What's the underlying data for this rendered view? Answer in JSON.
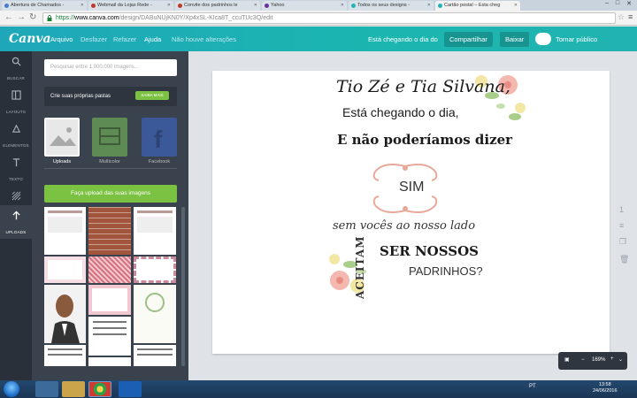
{
  "browser": {
    "tabs": [
      {
        "label": "Abertura de Chamados -",
        "color": "#4a7bd0"
      },
      {
        "label": "Webmail da Lojas Rede -",
        "color": "#c0392b"
      },
      {
        "label": "Convite dos padrinhos le",
        "color": "#c0392b"
      },
      {
        "label": "Yahoo",
        "color": "#6b2fa0"
      },
      {
        "label": "Todos os seus designs -",
        "color": "#1fb5b8"
      },
      {
        "label": "Cartão postal – Esta cheg",
        "color": "#1fb5b8"
      }
    ],
    "url_scheme": "https://",
    "url_host": "www.canva.com",
    "url_path": "/design/DABuNUjKN0Y/Xp4xSL-KIca8T_ccuTUc3Q/edit",
    "back_icon": "back-arrow-icon",
    "forward_icon": "forward-arrow-icon",
    "reload_icon": "reload-icon"
  },
  "header": {
    "logo": "Canva",
    "menu": [
      "Arquivo",
      "Desfazer",
      "Refazer",
      "Ajuda"
    ],
    "status": "Não houve alterações",
    "design_title": "Está chegando o dia do",
    "share": "Compartilhar",
    "download": "Baixar",
    "make_public": "Tornar público"
  },
  "rail": [
    {
      "label": "BUSCAR",
      "icon": "search-icon",
      "active": false
    },
    {
      "label": "LAYOUTS",
      "icon": "layouts-icon",
      "active": false
    },
    {
      "label": "ELEMENTOS",
      "icon": "elements-icon",
      "active": false
    },
    {
      "label": "TEXTO",
      "icon": "text-icon",
      "active": false
    },
    {
      "label": "FUNDO",
      "icon": "background-icon",
      "active": false
    },
    {
      "label": "UPLOADS",
      "icon": "upload-icon",
      "active": true
    }
  ],
  "panel": {
    "search_placeholder": "Pesquisar entre 1.000.000 imagens...",
    "folder_label": "Crie suas próprias pastas",
    "folder_button": "SAIBA MAIS",
    "sources": [
      "Uploads",
      "Multicolor",
      "Facebook"
    ],
    "upload_button": "Faça upload das suas imagens"
  },
  "card": {
    "line1": "Tio Zé e Tia Silvana,",
    "line2": "Está chegando o dia,",
    "line3": "E não poderíamos dizer",
    "sim": "SIM",
    "line4": "sem vocês ao nosso lado",
    "aceitam": "ACEITAM",
    "ser": "SER NOSSOS",
    "padrinhos": "PADRINHOS?"
  },
  "zoom": "169%",
  "taskbar": {
    "lang": "PT",
    "time": "13:58",
    "date": "24/06/2016"
  },
  "colors": {
    "canva_teal": "#1fa7b9",
    "upload_green": "#7bc142",
    "rail_dark": "#293039",
    "panel_dark": "#3a434d"
  }
}
